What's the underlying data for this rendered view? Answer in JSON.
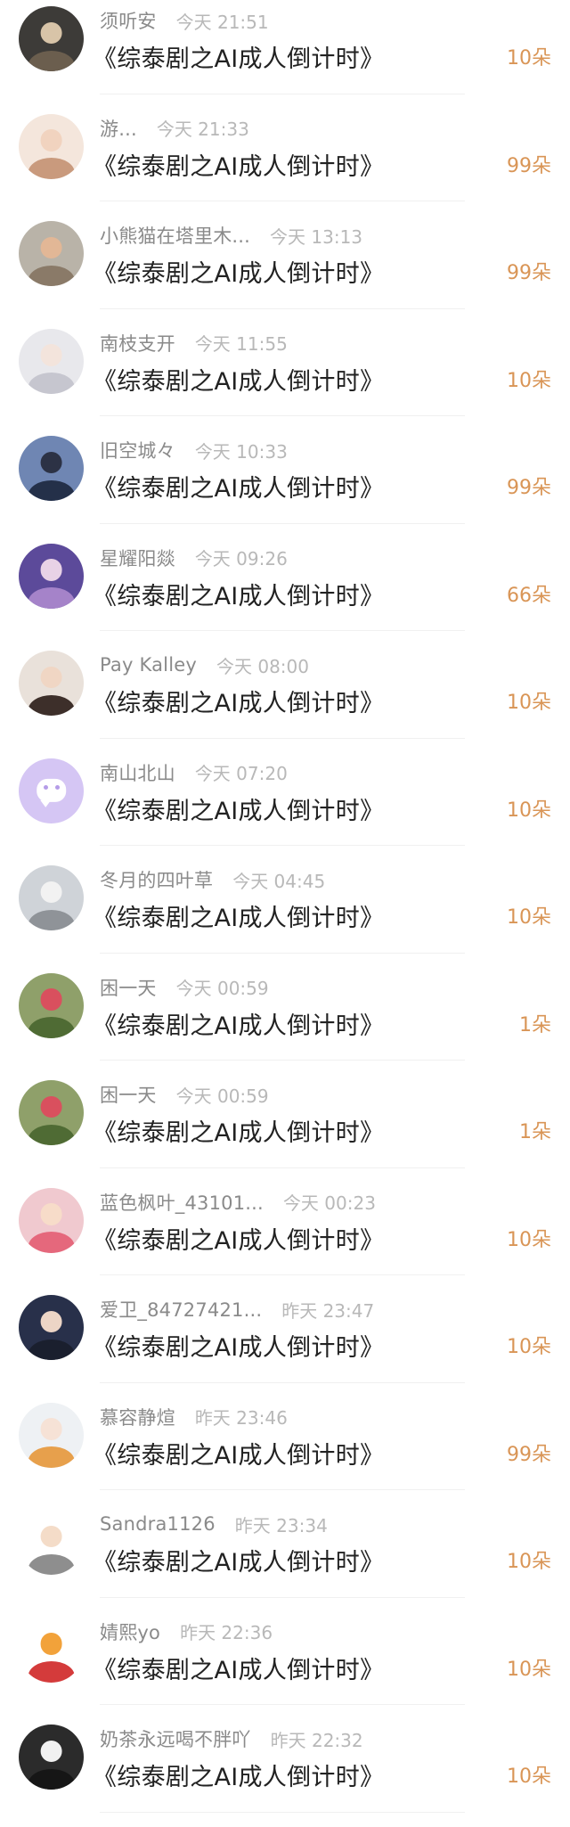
{
  "gift_list": {
    "items": [
      {
        "username": "须听安",
        "time": "今天 21:51",
        "title": "《综泰剧之AI成人倒计时》",
        "amount": "10朵",
        "avatar": {
          "bg": "#3d3b38",
          "skin": "#d8c4a8",
          "cloth": "#6b5e4e",
          "type": "photo"
        }
      },
      {
        "username": "游...",
        "time": "今天 21:33",
        "title": "《综泰剧之AI成人倒计时》",
        "amount": "99朵",
        "avatar": {
          "bg": "#f4e6dc",
          "skin": "#f1d3bf",
          "cloth": "#c99a7d",
          "type": "photo"
        }
      },
      {
        "username": "小熊猫在塔里木...",
        "time": "今天 13:13",
        "title": "《综泰剧之AI成人倒计时》",
        "amount": "99朵",
        "avatar": {
          "bg": "#b9b3a8",
          "skin": "#e2b796",
          "cloth": "#8a7a68",
          "type": "photo"
        }
      },
      {
        "username": "南枝支开",
        "time": "今天 11:55",
        "title": "《综泰剧之AI成人倒计时》",
        "amount": "10朵",
        "avatar": {
          "bg": "#e8e8ec",
          "skin": "#f3e4dc",
          "cloth": "#c6c6cf",
          "type": "photo"
        }
      },
      {
        "username": "旧空城々",
        "time": "今天 10:33",
        "title": "《综泰剧之AI成人倒计时》",
        "amount": "99朵",
        "avatar": {
          "bg": "#6f86b3",
          "skin": "#2c3245",
          "cloth": "#243049",
          "type": "photo"
        }
      },
      {
        "username": "星耀阳燚",
        "time": "今天 09:26",
        "title": "《综泰剧之AI成人倒计时》",
        "amount": "66朵",
        "avatar": {
          "bg": "#5c4a9a",
          "skin": "#e8d2e6",
          "cloth": "#a583c9",
          "type": "photo"
        }
      },
      {
        "username": "Pay Kalley",
        "time": "今天 08:00",
        "title": "《综泰剧之AI成人倒计时》",
        "amount": "10朵",
        "avatar": {
          "bg": "#e9e1da",
          "skin": "#f0d6c4",
          "cloth": "#3d2f2a",
          "type": "photo"
        }
      },
      {
        "username": "南山北山",
        "time": "今天 07:20",
        "title": "《综泰剧之AI成人倒计时》",
        "amount": "10朵",
        "avatar": {
          "bg": "#d5c6f4",
          "skin": "#ffffff",
          "cloth": "#ffffff",
          "type": "bubble"
        }
      },
      {
        "username": "冬月的四叶草",
        "time": "今天 04:45",
        "title": "《综泰剧之AI成人倒计时》",
        "amount": "10朵",
        "avatar": {
          "bg": "#cfd3d8",
          "skin": "#f2f2f2",
          "cloth": "#8f9398",
          "type": "photo"
        }
      },
      {
        "username": "困一天",
        "time": "今天 00:59",
        "title": "《综泰剧之AI成人倒计时》",
        "amount": "1朵",
        "avatar": {
          "bg": "#8fa06a",
          "skin": "#d9505e",
          "cloth": "#4f6b34",
          "type": "photo"
        }
      },
      {
        "username": "困一天",
        "time": "今天 00:59",
        "title": "《综泰剧之AI成人倒计时》",
        "amount": "1朵",
        "avatar": {
          "bg": "#8fa06a",
          "skin": "#d9505e",
          "cloth": "#4f6b34",
          "type": "photo"
        }
      },
      {
        "username": "蓝色枫叶_43101...",
        "time": "今天 00:23",
        "title": "《综泰剧之AI成人倒计时》",
        "amount": "10朵",
        "avatar": {
          "bg": "#f0c9cf",
          "skin": "#f7dcc9",
          "cloth": "#e5687c",
          "type": "photo"
        }
      },
      {
        "username": "爱卫_84727421...",
        "time": "昨天 23:47",
        "title": "《综泰剧之AI成人倒计时》",
        "amount": "10朵",
        "avatar": {
          "bg": "#28304a",
          "skin": "#ecd5c6",
          "cloth": "#1a1f2e",
          "type": "photo"
        }
      },
      {
        "username": "慕容静煊",
        "time": "昨天 23:46",
        "title": "《综泰剧之AI成人倒计时》",
        "amount": "99朵",
        "avatar": {
          "bg": "#eef1f4",
          "skin": "#f6e2d6",
          "cloth": "#e7a04c",
          "type": "photo"
        }
      },
      {
        "username": "Sandra1126",
        "time": "昨天 23:34",
        "title": "《综泰剧之AI成人倒计时》",
        "amount": "10朵",
        "avatar": {
          "bg": "#ffffff",
          "skin": "#f4dcc8",
          "cloth": "#8e8e8e",
          "type": "photo"
        }
      },
      {
        "username": "婧熙yo",
        "time": "昨天 22:36",
        "title": "《综泰剧之AI成人倒计时》",
        "amount": "10朵",
        "avatar": {
          "bg": "#ffffff",
          "skin": "#f2a23a",
          "cloth": "#d43b3b",
          "type": "photo"
        }
      },
      {
        "username": "奶茶永远喝不胖吖",
        "time": "昨天 22:32",
        "title": "《综泰剧之AI成人倒计时》",
        "amount": "10朵",
        "avatar": {
          "bg": "#2b2b2b",
          "skin": "#f1f1f1",
          "cloth": "#161616",
          "type": "photo"
        }
      }
    ]
  },
  "colors": {
    "username": "#8a8a8a",
    "time": "#b8b8b8",
    "title": "#222222",
    "amount": "#d99556",
    "divider": "#f0f0f0"
  }
}
